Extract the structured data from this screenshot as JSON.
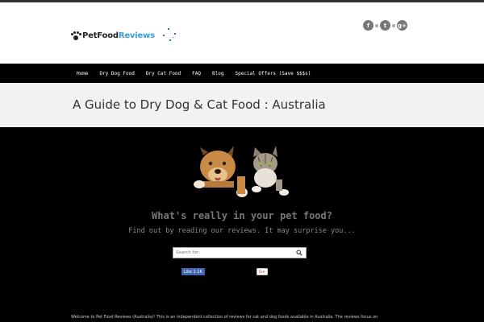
{
  "header": {
    "logo_part1": "PetFood",
    "logo_part2": "Reviews",
    "social": [
      {
        "icon": "facebook-icon",
        "glyph": "f"
      },
      {
        "icon": "twitter-icon",
        "glyph": "t"
      },
      {
        "icon": "google-plus-icon",
        "glyph": "g+"
      }
    ]
  },
  "nav": {
    "items": [
      "Home",
      "Dry Dog Food",
      "Dry Cat Food",
      "FAQ",
      "Blog",
      "Special Offers (Save $$$s)"
    ]
  },
  "page": {
    "title": "A Guide to Dry Dog & Cat Food : Australia"
  },
  "hero": {
    "headline": "What's really in your pet food?",
    "subline": "Find out by reading our reviews. It may surprise you...",
    "search_placeholder": "Search for:",
    "fb_like": "Like 1.1K",
    "gplus": "G+"
  },
  "intro": {
    "text": "Welcome to Pet Food Reviews (Australia)! This is an independent collection of reviews for cat and dog foods available in Australia. The reviews focus on"
  },
  "colors": {
    "accent": "#3a9ad9",
    "nav_bg": "#000000",
    "title_bg": "#f2f2f2"
  }
}
